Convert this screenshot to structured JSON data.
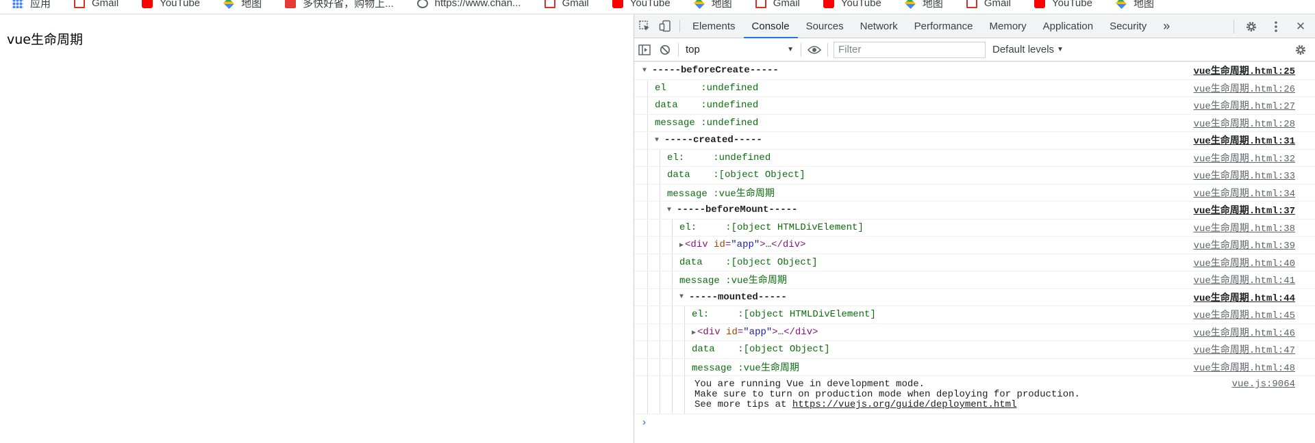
{
  "bookmarks": [
    {
      "label": "应用",
      "icon": "apps-icon"
    },
    {
      "label": "Gmail",
      "icon": "gmail-icon"
    },
    {
      "label": "YouTube",
      "icon": "youtube-icon"
    },
    {
      "label": "地图",
      "icon": "maps-icon"
    },
    {
      "label": "多快好省，购物上...",
      "icon": "shop-icon"
    },
    {
      "label": "https://www.chan...",
      "icon": "globe-icon"
    },
    {
      "label": "Gmail",
      "icon": "gmail-icon"
    },
    {
      "label": "YouTube",
      "icon": "youtube-icon"
    },
    {
      "label": "地图",
      "icon": "maps-icon"
    },
    {
      "label": "Gmail",
      "icon": "gmail-icon"
    },
    {
      "label": "YouTube",
      "icon": "youtube-icon"
    },
    {
      "label": "地图",
      "icon": "maps-icon"
    },
    {
      "label": "Gmail",
      "icon": "gmail-icon"
    },
    {
      "label": "YouTube",
      "icon": "youtube-icon"
    },
    {
      "label": "地图",
      "icon": "maps-icon"
    }
  ],
  "page": {
    "heading": "vue生命周期"
  },
  "devtools": {
    "tabs": [
      "Elements",
      "Console",
      "Sources",
      "Network",
      "Performance",
      "Memory",
      "Application",
      "Security"
    ],
    "active_tab": "Console",
    "more_tabs": "»",
    "close": "✕",
    "toolbar": {
      "context": "top",
      "filter_placeholder": "Filter",
      "levels": "Default levels"
    }
  },
  "console": {
    "groups": [
      {
        "title": "-----beforeCreate-----",
        "src": "vue生命周期.html:25",
        "depth": 0,
        "rows": [
          {
            "text": "el      :undefined",
            "src": "vue生命周期.html:26"
          },
          {
            "text": "data    :undefined",
            "src": "vue生命周期.html:27"
          },
          {
            "text": "message :undefined",
            "src": "vue生命周期.html:28"
          }
        ]
      },
      {
        "title": "-----created-----",
        "src": "vue生命周期.html:31",
        "depth": 1,
        "rows": [
          {
            "text": "el:     :undefined",
            "src": "vue生命周期.html:32"
          },
          {
            "text": "data    :[object Object]",
            "src": "vue生命周期.html:33"
          },
          {
            "text": "message :vue生命周期",
            "src": "vue生命周期.html:34"
          }
        ]
      },
      {
        "title": "-----beforeMount-----",
        "src": "vue生命周期.html:37",
        "depth": 2,
        "rows": [
          {
            "text": "el:     :[object HTMLDivElement]",
            "src": "vue生命周期.html:38"
          },
          {
            "element": true,
            "tag_open": "<div",
            "attr": " id",
            "eq": "=",
            "attr_value": "\"app\"",
            "tag_close": ">",
            "ellipsis": "…",
            "end_tag": "</div>",
            "src": "vue生命周期.html:39"
          },
          {
            "text": "data    :[object Object]",
            "src": "vue生命周期.html:40"
          },
          {
            "text": "message :vue生命周期",
            "src": "vue生命周期.html:41"
          }
        ]
      },
      {
        "title": "-----mounted-----",
        "src": "vue生命周期.html:44",
        "depth": 3,
        "rows": [
          {
            "text": "el:     :[object HTMLDivElement]",
            "src": "vue生命周期.html:45"
          },
          {
            "element": true,
            "tag_open": "<div",
            "attr": " id",
            "eq": "=",
            "attr_value": "\"app\"",
            "tag_close": ">",
            "ellipsis": "…",
            "end_tag": "</div>",
            "src": "vue生命周期.html:46"
          },
          {
            "text": "data    :[object Object]",
            "src": "vue生命周期.html:47"
          },
          {
            "text": "message :vue生命周期",
            "src": "vue生命周期.html:48"
          }
        ]
      }
    ],
    "vue_notice": {
      "line1": "You are running Vue in development mode.",
      "line2": "Make sure to turn on production mode when deploying for production.",
      "line3_prefix": "See more tips at ",
      "line3_link": "https://vuejs.org/guide/deployment.html",
      "src": "vue.js:9064"
    },
    "prompt": "›"
  }
}
